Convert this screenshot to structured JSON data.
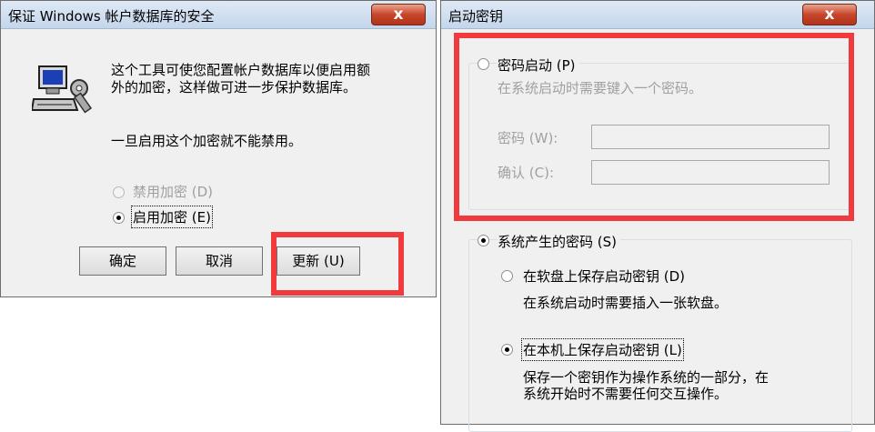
{
  "left_dialog": {
    "title": "保证 Windows 帐户数据库的安全",
    "close_symbol": "x",
    "description_line1": "这个工具可使您配置帐户数据库以便启用额",
    "description_line2": "外的加密，这样做可进一步保护数据库。",
    "warning": "一旦启用这个加密就不能禁用。",
    "radio_disable": "禁用加密 (D)",
    "radio_enable": "启用加密 (E)",
    "btn_ok": "确定",
    "btn_cancel": "取消",
    "btn_update": "更新 (U)"
  },
  "right_dialog": {
    "title": "启动密钥",
    "close_symbol": "x",
    "radio_password_startup": "密码启动 (P)",
    "password_startup_desc": "在系统启动时需要键入一个密码。",
    "password_label": "密码 (W):",
    "confirm_label": "确认 (C):",
    "password_value": "",
    "confirm_value": "",
    "radio_system_generated": "系统产生的密码 (S)",
    "radio_floppy": "在软盘上保存启动密钥 (D)",
    "floppy_desc": "在系统启动时需要插入一张软盘。",
    "radio_local": "在本机上保存启动密钥 (L)",
    "local_desc_line1": "保存一个密钥作为操作系统的一部分，在",
    "local_desc_line2": "系统开始时不需要任何交互操作。"
  },
  "highlight_color": "#f03a3e"
}
